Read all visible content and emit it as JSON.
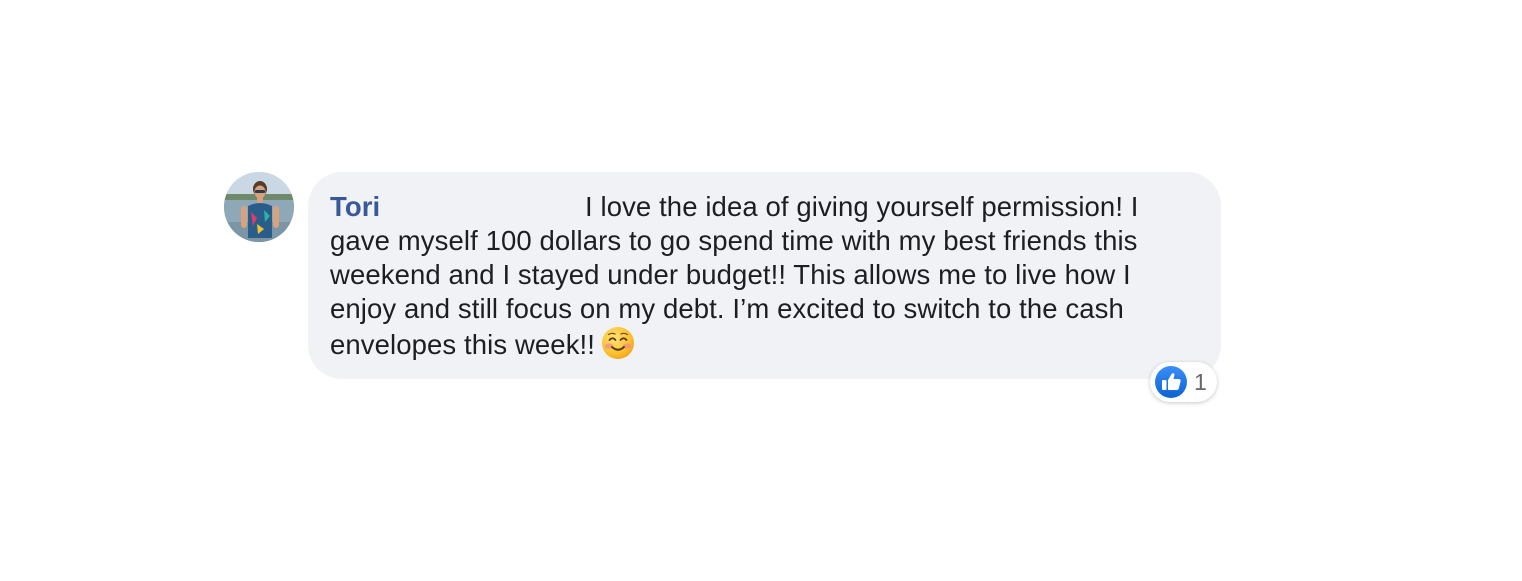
{
  "comment": {
    "author": "Tori",
    "text": "I love the idea of giving yourself permission! I gave myself 100 dollars to go spend time with my best friends this weekend and I stayed under budget!! This allows me to live how I enjoy and still focus on my debt. I’m excited to switch to the cash envelopes this week!!",
    "emoji": "smiling-face-with-smiling-eyes",
    "avatar": "profile-photo"
  },
  "reactions": {
    "icon": "like-icon",
    "count": "1",
    "color": "#1877f2"
  },
  "colors": {
    "bubble": "#f0f2f5",
    "author": "#385898",
    "text": "#1c1e21"
  }
}
